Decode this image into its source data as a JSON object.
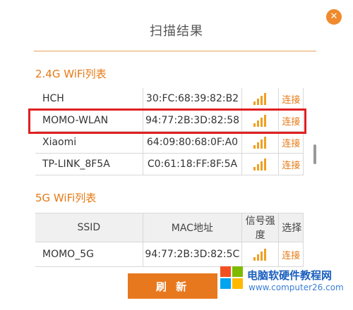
{
  "dialog": {
    "title": "扫描结果",
    "close_glyph": "✕"
  },
  "wifi_24g": {
    "heading": "2.4G WiFi列表",
    "rows": [
      {
        "ssid": "HCH",
        "mac": "30:FC:68:39:82:B2",
        "signal": 4,
        "action": "连接"
      },
      {
        "ssid": "MOMO-WLAN",
        "mac": "94:77:2B:3D:82:58",
        "signal": 4,
        "action": "连接"
      },
      {
        "ssid": "Xiaomi",
        "mac": "64:09:80:68:0F:A0",
        "signal": 4,
        "action": "连接"
      },
      {
        "ssid": "TP-LINK_8F5A",
        "mac": "C0:61:18:FF:8F:5A",
        "signal": 4,
        "action": "连接"
      }
    ]
  },
  "wifi_5g": {
    "heading": "5G WiFi列表",
    "columns": [
      "SSID",
      "MAC地址",
      "信号强度",
      "选择"
    ],
    "rows": [
      {
        "ssid": "MOMO_5G",
        "mac": "94:77:2B:3D:82:5C",
        "signal": 4,
        "action": "连接"
      }
    ]
  },
  "refresh_label": "刷 新",
  "watermark": {
    "line1": "电脑软硬件教程网",
    "line2": "www.computer26.com"
  },
  "colors": {
    "accent": "#e8781e",
    "highlight": "#e02020",
    "signal": "#f0a020"
  },
  "icons": {
    "close": "close-icon",
    "signal": "signal-strength-icon",
    "logo": "windows-logo-icon"
  }
}
